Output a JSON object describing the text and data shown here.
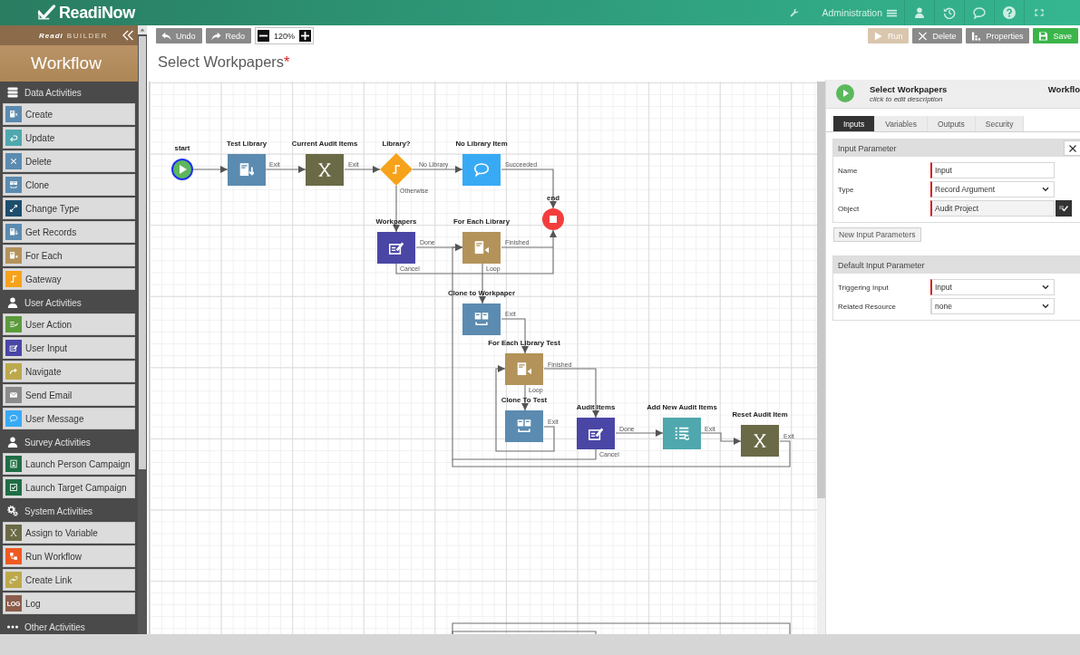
{
  "header": {
    "logo": "ReadiNow",
    "admin_menu": "Administration"
  },
  "sidebar": {
    "brand": "Readi",
    "product": "BUILDER",
    "title": "Workflow",
    "sections": [
      {
        "title": "Data Activities",
        "kind": "data",
        "items": [
          {
            "label": "Create",
            "kind": "create"
          },
          {
            "label": "Update",
            "kind": "update"
          },
          {
            "label": "Delete",
            "kind": "delete"
          },
          {
            "label": "Clone",
            "kind": "clone"
          },
          {
            "label": "Change Type",
            "kind": "change-type"
          },
          {
            "label": "Get Records",
            "kind": "get-records"
          },
          {
            "label": "For Each",
            "kind": "for-each"
          },
          {
            "label": "Gateway",
            "kind": "gateway"
          }
        ]
      },
      {
        "title": "User Activities",
        "kind": "user",
        "items": [
          {
            "label": "User Action",
            "kind": "user-action"
          },
          {
            "label": "User Input",
            "kind": "user-input"
          },
          {
            "label": "Navigate",
            "kind": "navigate"
          },
          {
            "label": "Send Email",
            "kind": "send-email"
          },
          {
            "label": "User Message",
            "kind": "message"
          }
        ]
      },
      {
        "title": "Survey Activities",
        "kind": "survey",
        "items": [
          {
            "label": "Launch Person Campaign",
            "kind": "launch-person"
          },
          {
            "label": "Launch Target Campaign",
            "kind": "launch-target"
          }
        ]
      },
      {
        "title": "System Activities",
        "kind": "system",
        "items": [
          {
            "label": "Assign to Variable",
            "kind": "assign"
          },
          {
            "label": "Run Workflow",
            "kind": "run-workflow"
          },
          {
            "label": "Create Link",
            "kind": "create-link"
          },
          {
            "label": "Log",
            "kind": "log",
            "icon_text": "LOG"
          }
        ]
      },
      {
        "title": "Other Activities",
        "kind": "other"
      }
    ]
  },
  "toolbar": {
    "history": [
      {
        "label": "Undo",
        "kind": "undo"
      },
      {
        "label": "Redo",
        "kind": "redo"
      }
    ],
    "zoom": "120%",
    "actions": [
      {
        "label": "Run",
        "kind": "run",
        "disabled": true
      },
      {
        "label": "Delete",
        "kind": "delete",
        "disabled": false
      },
      {
        "label": "Properties",
        "kind": "properties",
        "disabled": false
      },
      {
        "label": "Save",
        "kind": "save",
        "disabled": false
      }
    ]
  },
  "title": {
    "text": "Select Workpapers",
    "marker": "*"
  },
  "diagram": {
    "nodes": [
      {
        "label": "start",
        "kind": "start"
      },
      {
        "label": "Test Library",
        "kind": "get-records"
      },
      {
        "label": "Current Audit Items",
        "kind": "assign"
      },
      {
        "label": "Library?",
        "kind": "gateway"
      },
      {
        "label": "No Library Item",
        "kind": "message"
      },
      {
        "label": "end",
        "kind": "end"
      },
      {
        "label": "Workpapers",
        "kind": "user-input"
      },
      {
        "label": "For Each Library",
        "kind": "for-each"
      },
      {
        "label": "Clone to Workpaper",
        "kind": "clone"
      },
      {
        "label": "For Each Library Test",
        "kind": "for-each"
      },
      {
        "label": "Clone To Test",
        "kind": "clone"
      },
      {
        "label": "Audit Items",
        "kind": "user-input"
      },
      {
        "label": "Add New Audit Items",
        "kind": "update"
      },
      {
        "label": "Reset Audit Item",
        "kind": "assign"
      }
    ],
    "links": [
      {
        "label": "Exit"
      },
      {
        "label": "Exit"
      },
      {
        "label": "No Library"
      },
      {
        "label": "Succeeded"
      },
      {
        "label": "Otherwise"
      },
      {
        "label": "Done"
      },
      {
        "label": "Finished"
      },
      {
        "label": "Cancel"
      },
      {
        "label": "Loop"
      },
      {
        "label": "Exit"
      },
      {
        "label": "Finished"
      },
      {
        "label": "Loop"
      },
      {
        "label": "Exit"
      },
      {
        "label": "Done"
      },
      {
        "label": "Cancel"
      },
      {
        "label": "Exit"
      },
      {
        "label": "Exit"
      }
    ]
  },
  "panel": {
    "name": "Select Workpapers",
    "description": "click to edit description",
    "type": "Workflo",
    "tabs": [
      {
        "label": "Inputs",
        "selected": true
      },
      {
        "label": "Variables",
        "selected": false
      },
      {
        "label": "Outputs",
        "selected": false
      },
      {
        "label": "Security",
        "selected": false
      }
    ],
    "sections": [
      {
        "title": "Input Parameter",
        "closable": true,
        "fields": [
          {
            "label": "Name",
            "kind": "text",
            "value": "Input",
            "required": true
          },
          {
            "label": "Type",
            "kind": "select",
            "value": "Record Argument",
            "required": true
          },
          {
            "label": "Object",
            "kind": "picker",
            "value": "Audit Project",
            "required": true
          }
        ],
        "button": "New Input Parameters"
      },
      {
        "title": "Default Input Parameter",
        "closable": false,
        "fields": [
          {
            "label": "Triggering Input",
            "kind": "select",
            "value": "Input",
            "required": true
          },
          {
            "label": "Related Resource",
            "kind": "select",
            "value": "none",
            "required": false
          }
        ]
      }
    ]
  }
}
